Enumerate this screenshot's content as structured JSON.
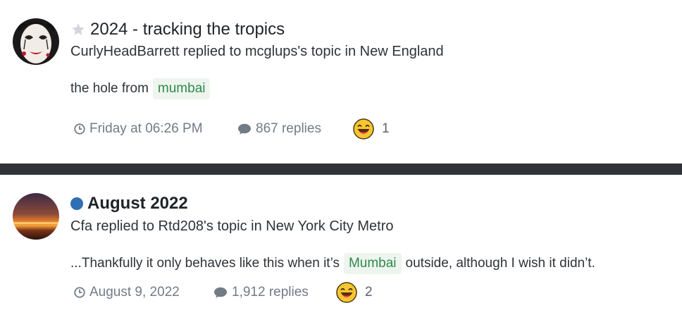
{
  "items": [
    {
      "title": "2024 - tracking the tropics",
      "title_marker": "star-icon",
      "byline": "CurlyHeadBarrett replied to mcglups's topic in New England",
      "snippet_before": "the hole from",
      "tag": "mumbai",
      "snippet_after": "",
      "date": "Friday at 06:26 PM",
      "replies": "867 replies",
      "reaction_count": "1"
    },
    {
      "title": "August 2022",
      "title_marker": "unread-dot-icon",
      "byline": "Cfa replied to Rtd208's topic in New York City Metro",
      "snippet_before": "...Thankfully it only behaves like this when it’s",
      "tag": "Mumbai",
      "snippet_after": "outside, although I wish it didn’t.",
      "date": "August 9, 2022",
      "replies": "1,912 replies",
      "reaction_count": "2"
    }
  ],
  "colors": {
    "divider": "#2f3338",
    "tag_bg": "#eef4ee",
    "tag_text": "#2f8a4c",
    "unread_dot": "#2f6fb3",
    "meta_text": "#737b86"
  }
}
